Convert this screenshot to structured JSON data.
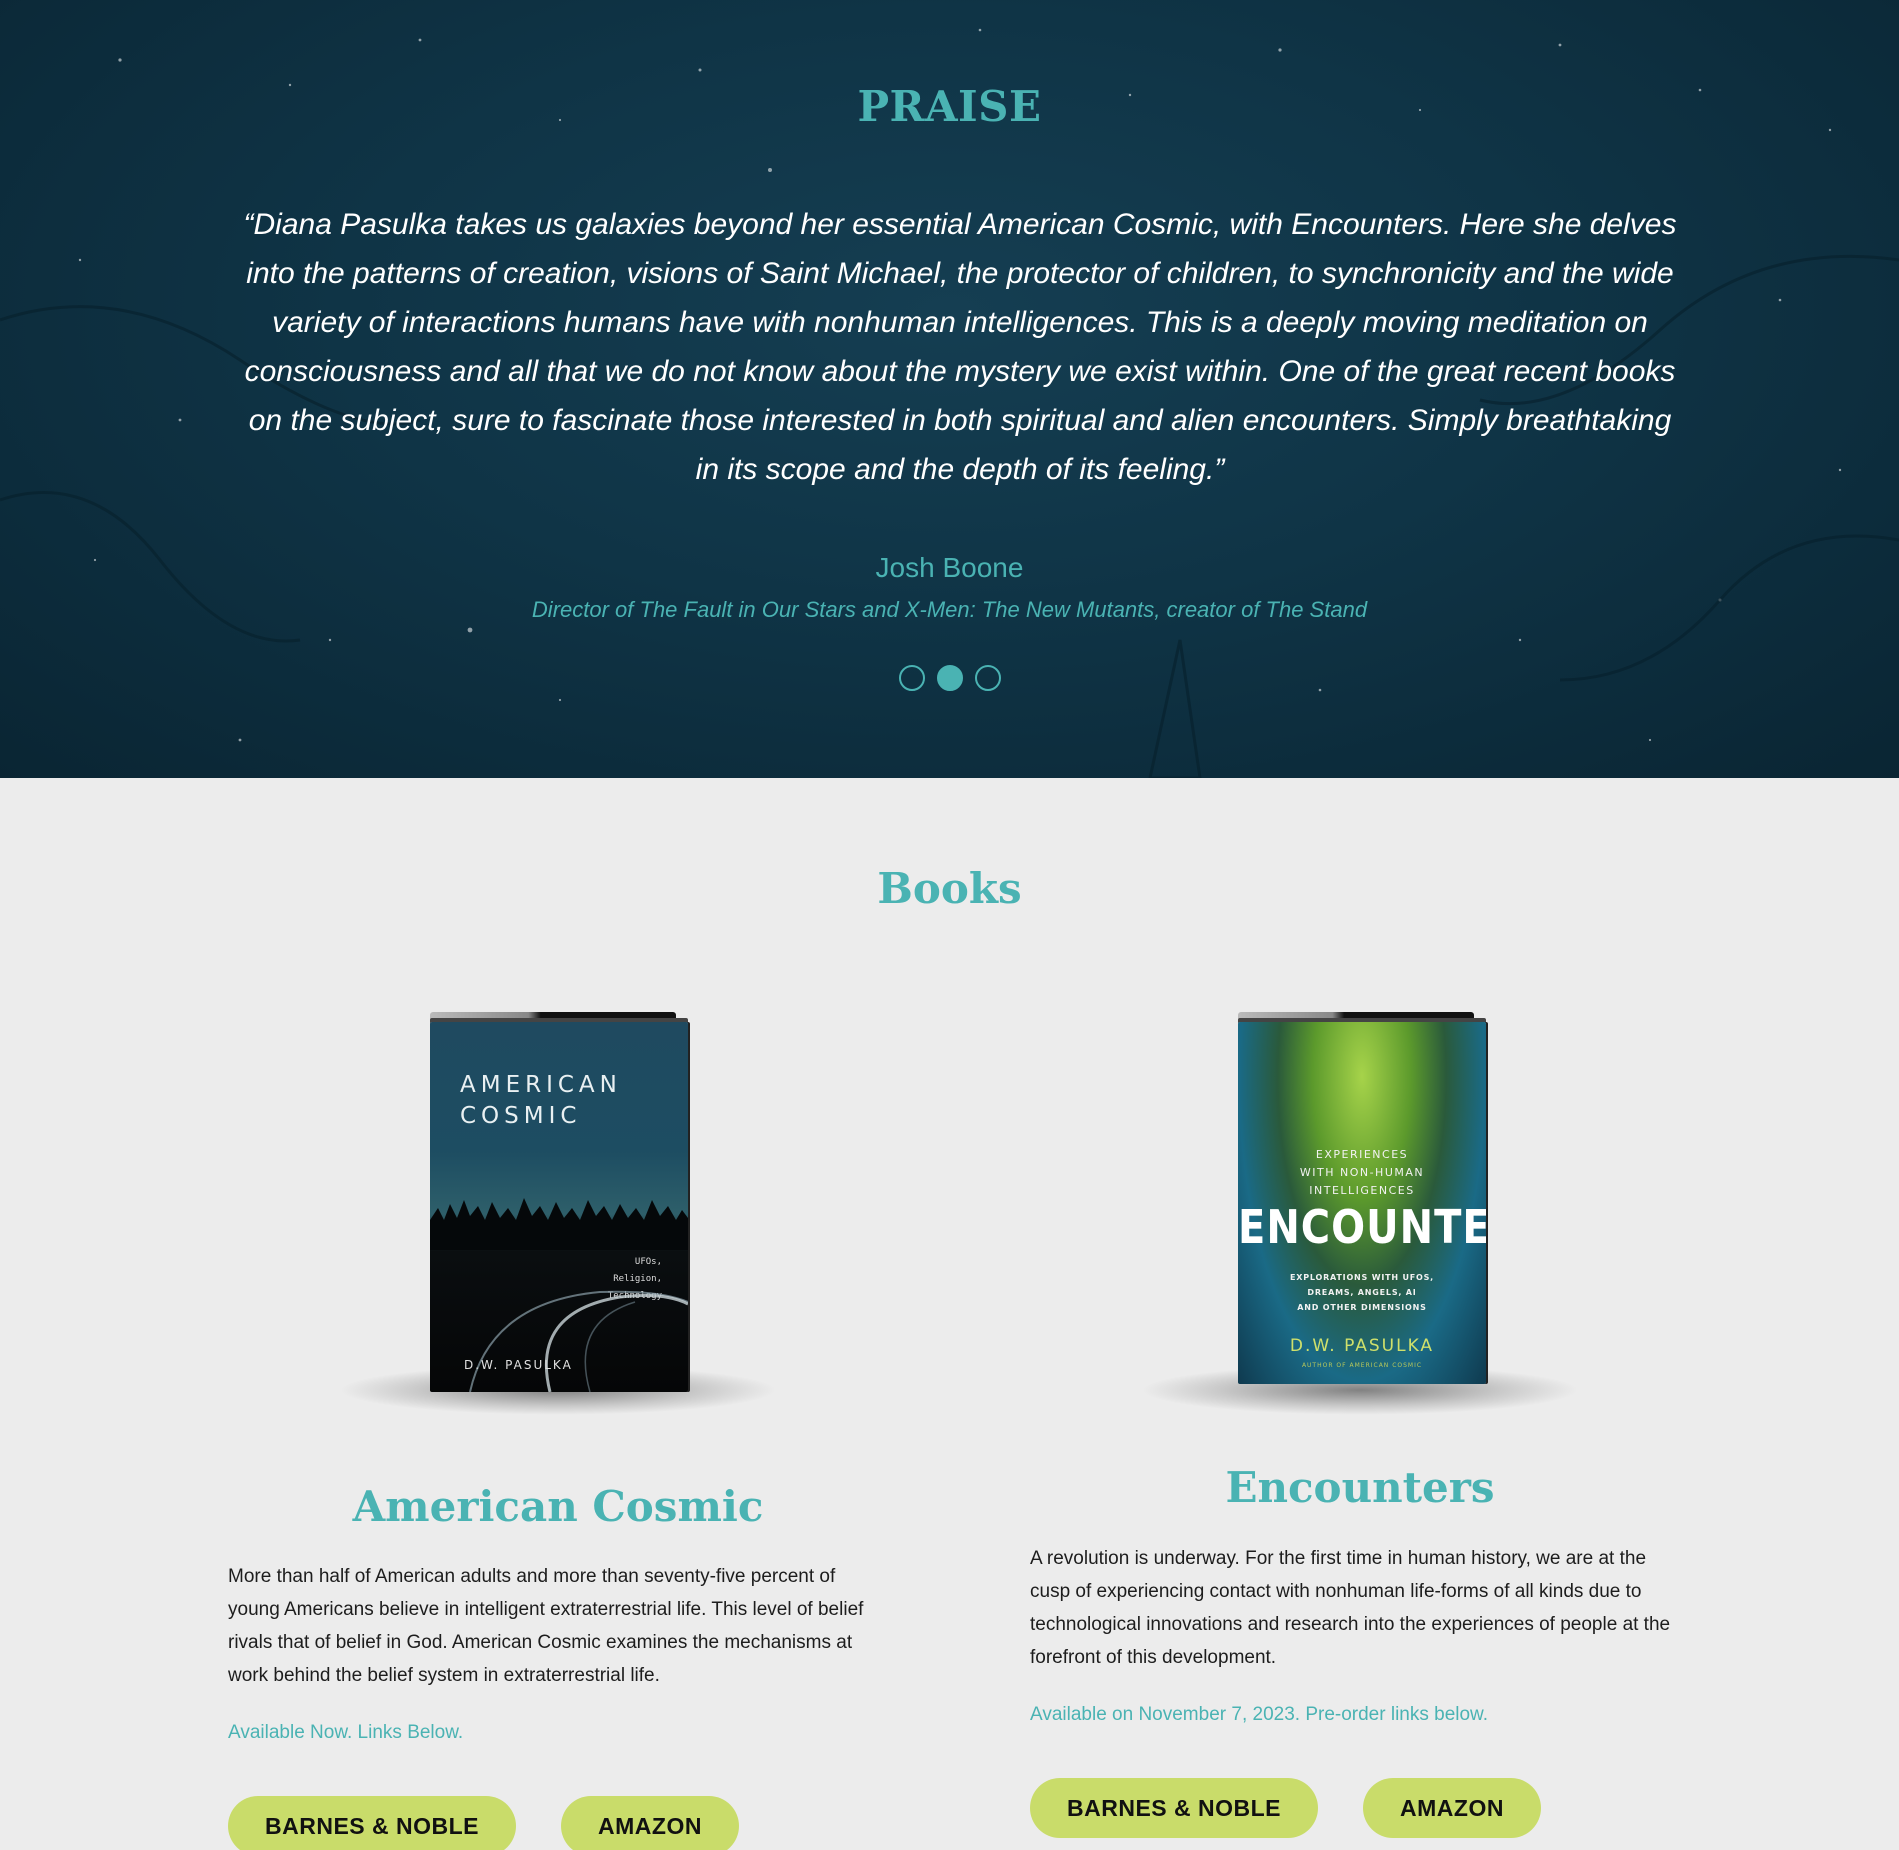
{
  "praise": {
    "title": "PRAISE",
    "quote": "“Diana Pasulka takes us galaxies beyond her essential American Cosmic, with Encounters. Here she delves into the patterns of creation, visions of Saint Michael, the protector of children, to synchronicity and the wide variety of interactions humans have with nonhuman intelligences. This is a deeply moving meditation on consciousness and all that we do not know about the mystery we exist within. One of the great recent books on the subject, sure to fascinate those interested in both spiritual and alien encounters. Simply breathtaking in its scope and the depth of its feeling.”",
    "author": "Josh Boone",
    "author_role": "Director of The Fault in Our Stars and X-Men: The New Mutants, creator of The Stand",
    "slides": 3,
    "active_slide": 2
  },
  "books": {
    "title": "Books",
    "items": [
      {
        "title": "American Cosmic",
        "cover": {
          "title_line1": "AMERICAN",
          "title_line2": "COSMIC",
          "subtitle_line1": "UFOs,",
          "subtitle_line2": "Religion,",
          "subtitle_line3": "Technology",
          "author": "D.W. PASULKA"
        },
        "description": "More than half of American adults and more than seventy-five percent of young Americans believe in intelligent extraterrestrial life. This level of belief rivals that of belief in God. American Cosmic examines the mechanisms at work behind the belief system in extraterrestrial life.",
        "availability": "Available Now. Links Below.",
        "buttons": [
          "BARNES & NOBLE",
          "AMAZON"
        ]
      },
      {
        "title": "Encounters",
        "cover": {
          "kicker_line1": "EXPERIENCES",
          "kicker_line2": "WITH NON-HUMAN",
          "kicker_line3": "INTELLIGENCES",
          "title": "ENCOUNTERS",
          "subtitle_line1": "EXPLORATIONS WITH UFOS,",
          "subtitle_line2": "DREAMS, ANGELS, AI",
          "subtitle_line3": "AND OTHER DIMENSIONS",
          "author": "D.W. PASULKA",
          "author_note": "AUTHOR OF AMERICAN COSMIC"
        },
        "description": "A revolution is underway. For the first time in human history, we are at the cusp of experiencing contact with nonhuman life-forms of all kinds due to technological innovations and research into the experiences of people at the forefront of this development.",
        "availability": "Available on November 7, 2023. Pre-order links below.",
        "buttons": [
          "BARNES & NOBLE",
          "AMAZON"
        ]
      }
    ]
  },
  "colors": {
    "accent": "#4ab3b3",
    "button": "#c9dc6a",
    "praise_bg": "#0f3446",
    "page_bg": "#ececec"
  }
}
